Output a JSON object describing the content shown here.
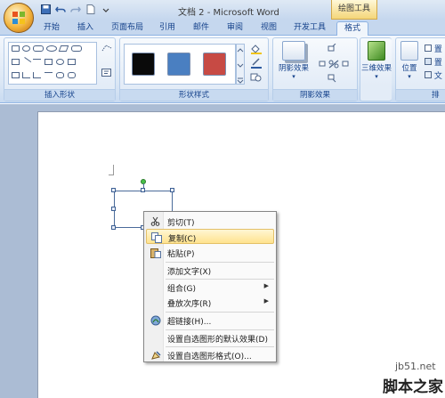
{
  "window": {
    "title": "文档 2 - Microsoft Word",
    "context_tab_header": "绘图工具"
  },
  "tabs": [
    {
      "label": "开始"
    },
    {
      "label": "插入"
    },
    {
      "label": "页面布局"
    },
    {
      "label": "引用"
    },
    {
      "label": "邮件"
    },
    {
      "label": "审阅"
    },
    {
      "label": "视图"
    },
    {
      "label": "开发工具"
    },
    {
      "label": "格式",
      "active": true
    }
  ],
  "ribbon": {
    "groups": {
      "insert_shapes": "插入形状",
      "shape_styles": "形状样式",
      "shadow_effects": "阴影效果",
      "arrange": "排"
    },
    "buttons": {
      "shadow_effect": "阴影效果",
      "3d_effect": "三维效果",
      "position": "位置",
      "text_wrap_1": "置",
      "text_wrap_2": "置",
      "text": "文"
    },
    "style_colors": [
      "#0a0a0a",
      "#4a7fc1",
      "#c74a44"
    ]
  },
  "context_menu": {
    "items": [
      {
        "label": "剪切(T)",
        "icon": "scissors-icon"
      },
      {
        "label": "复制(C)",
        "icon": "copy-icon",
        "highlighted": true
      },
      {
        "label": "粘贴(P)",
        "icon": "paste-icon"
      },
      {
        "label": "添加文字(X)",
        "icon": ""
      },
      {
        "label": "组合(G)",
        "icon": "",
        "submenu": true
      },
      {
        "label": "叠放次序(R)",
        "icon": "",
        "submenu": true
      },
      {
        "label": "超链接(H)...",
        "icon": "hyperlink-icon"
      },
      {
        "label": "设置自选图形的默认效果(D)",
        "icon": ""
      },
      {
        "label": "设置自选图形格式(O)...",
        "icon": "format-shape-icon"
      }
    ]
  },
  "watermark": {
    "url": "jb51.net",
    "name": "脚本之家"
  }
}
